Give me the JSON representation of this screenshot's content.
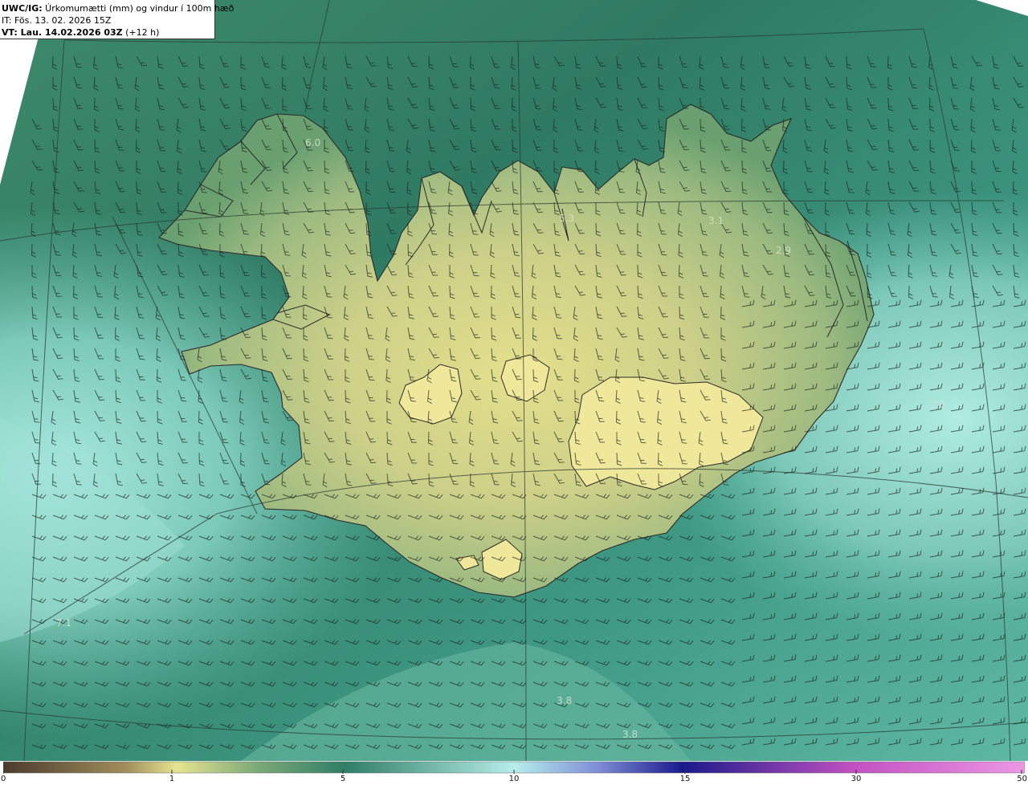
{
  "header": {
    "model": "UWC/IG:",
    "description": " Úrkomumætti (mm) og vindur í 100m hæð",
    "issue_time": "IT: Fös. 13. 02. 2026 15Z",
    "valid_prefix": "VT: Lau. 14.02.2026 03Z",
    "valid_suffix": " (+12 h)"
  },
  "map": {
    "region": "Iceland",
    "value_labels": [
      {
        "id": "westfjords",
        "text": "6.0"
      },
      {
        "id": "north-central",
        "text": "5.3"
      },
      {
        "id": "northeast",
        "text": "3.1"
      },
      {
        "id": "east",
        "text": "2.9"
      },
      {
        "id": "east-sea",
        "text": "2.6"
      },
      {
        "id": "southwest-sea",
        "text": "7.1"
      },
      {
        "id": "south-sea-1",
        "text": "3.8"
      },
      {
        "id": "south-sea-2",
        "text": "3.8"
      }
    ]
  },
  "colorbar": {
    "ticks": [
      {
        "label": "0",
        "value": 0
      },
      {
        "label": "1",
        "value": 1
      },
      {
        "label": "5",
        "value": 5
      },
      {
        "label": "10",
        "value": 10
      },
      {
        "label": "15",
        "value": 15
      },
      {
        "label": "30",
        "value": 30
      },
      {
        "label": "50",
        "value": 50
      }
    ],
    "colors": [
      "#4a3a2c",
      "#a89860",
      "#e8e890",
      "#2f7e66",
      "#b6eeea",
      "#1a1a8a",
      "#c050c0",
      "#e890e0"
    ]
  }
}
